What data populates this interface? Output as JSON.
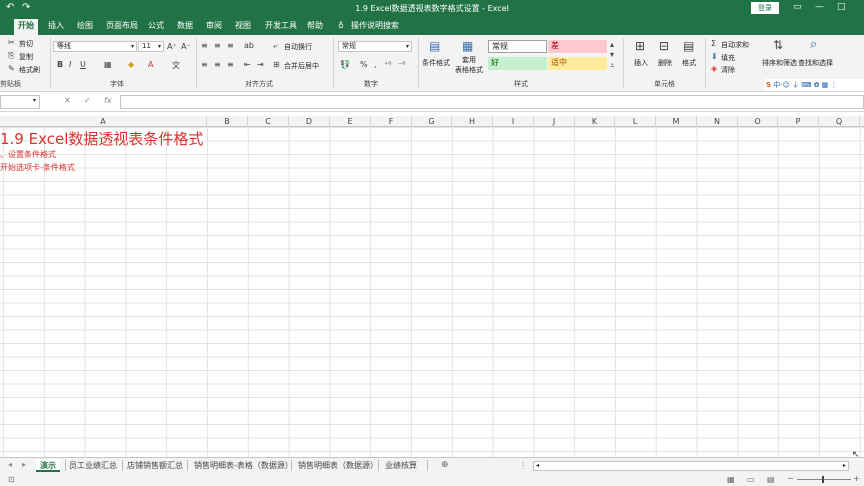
{
  "window": {
    "title": "1.9 Excel数据透视表数字格式设置 - Excel",
    "login": "登录",
    "colors": {
      "brand": "#217346",
      "accent_text": "#d9322d"
    }
  },
  "tabs": [
    "开始",
    "插入",
    "绘图",
    "页面布局",
    "公式",
    "数据",
    "审阅",
    "视图",
    "开发工具",
    "帮助"
  ],
  "tell_me": "操作说明搜索",
  "ribbon": {
    "clipboard": {
      "cut": "剪切",
      "copy": "复制",
      "format_painter": "格式刷",
      "label": "剪贴板"
    },
    "font": {
      "name": "等线",
      "size": "11",
      "label": "字体",
      "bold": "B",
      "italic": "I",
      "underline": "U"
    },
    "alignment": {
      "wrap": "自动换行",
      "merge": "合并后居中",
      "label": "对齐方式"
    },
    "number": {
      "format": "常规",
      "label": "数字"
    },
    "styles": {
      "conditional": "条件格式",
      "table": "套用\n表格格式",
      "normal": "常规",
      "bad": "差",
      "good": "好",
      "neutral": "适中",
      "label": "样式"
    },
    "cells": {
      "insert": "插入",
      "delete": "删除",
      "format": "格式",
      "label": "单元格"
    },
    "editing": {
      "autosum": "自动求和",
      "fill": "填充",
      "clear": "清除",
      "sort": "排序和筛选",
      "find": "查找和选择"
    }
  },
  "formula_bar": {
    "fx": "fx"
  },
  "columns": [
    "A",
    "B",
    "C",
    "D",
    "E",
    "F",
    "G",
    "H",
    "I",
    "J",
    "K",
    "L",
    "M",
    "N",
    "O",
    "P",
    "Q"
  ],
  "cells": {
    "a1": "1.9 Excel数据透视表条件格式",
    "a2": "、设置条件格式",
    "a3": "开始选项卡-条件格式"
  },
  "sheets": [
    "演示",
    "员工业绩汇总",
    "店铺销售额汇总",
    "销售明细表-表格（数据源）",
    "销售明细表（数据源）",
    "业绩核算"
  ],
  "active_sheet": "演示"
}
